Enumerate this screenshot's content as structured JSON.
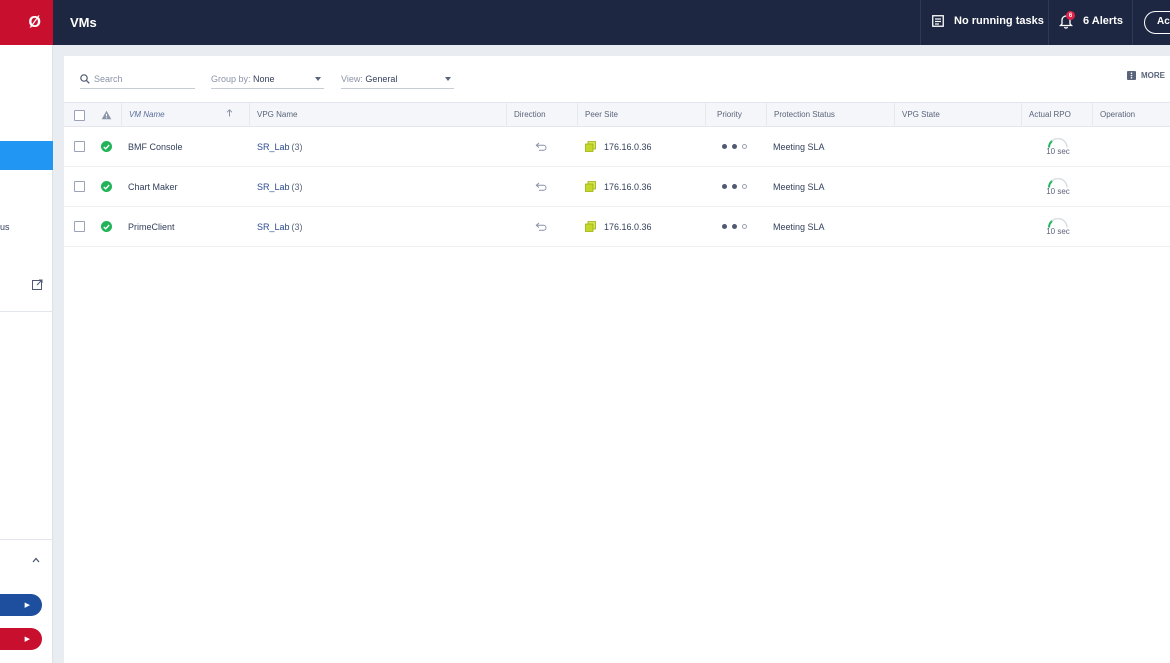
{
  "sidebar": {
    "logo_text": "Ø",
    "partial_label": "us",
    "colors": {
      "active": "#2196f3",
      "pill_blue": "#1d4f9e",
      "pill_red": "#c8102e"
    }
  },
  "topbar": {
    "title": "VMs",
    "tasks_label": "No running tasks",
    "alerts_label": "6 Alerts",
    "alerts_badge": "6",
    "action_label": "Ac"
  },
  "toolbar": {
    "search_placeholder": "Search",
    "group_by_label": "Group by:",
    "group_by_value": "None",
    "view_label": "View:",
    "view_value": "General",
    "more_label": "MORE"
  },
  "table": {
    "columns": {
      "vm_name": "VM Name",
      "vpg_name": "VPG Name",
      "direction": "Direction",
      "peer_site": "Peer Site",
      "priority": "Priority",
      "protection_status": "Protection Status",
      "vpg_state": "VPG State",
      "actual_rpo": "Actual RPO",
      "operation": "Operation"
    },
    "rows": [
      {
        "vm_name": "BMF Console",
        "vpg_name": "SR_Lab",
        "vpg_count": "(3)",
        "peer_site": "176.16.0.36",
        "priority": 2,
        "protection_status": "Meeting SLA",
        "vpg_state": "",
        "actual_rpo": "10 sec",
        "operation": ""
      },
      {
        "vm_name": "Chart Maker",
        "vpg_name": "SR_Lab",
        "vpg_count": "(3)",
        "peer_site": "176.16.0.36",
        "priority": 2,
        "protection_status": "Meeting SLA",
        "vpg_state": "",
        "actual_rpo": "10 sec",
        "operation": ""
      },
      {
        "vm_name": "PrimeClient",
        "vpg_name": "SR_Lab",
        "vpg_count": "(3)",
        "peer_site": "176.16.0.36",
        "priority": 2,
        "protection_status": "Meeting SLA",
        "vpg_state": "",
        "actual_rpo": "10 sec",
        "operation": ""
      }
    ],
    "status_color": "#21b35a",
    "site_icon_color": "#b5cc18"
  }
}
